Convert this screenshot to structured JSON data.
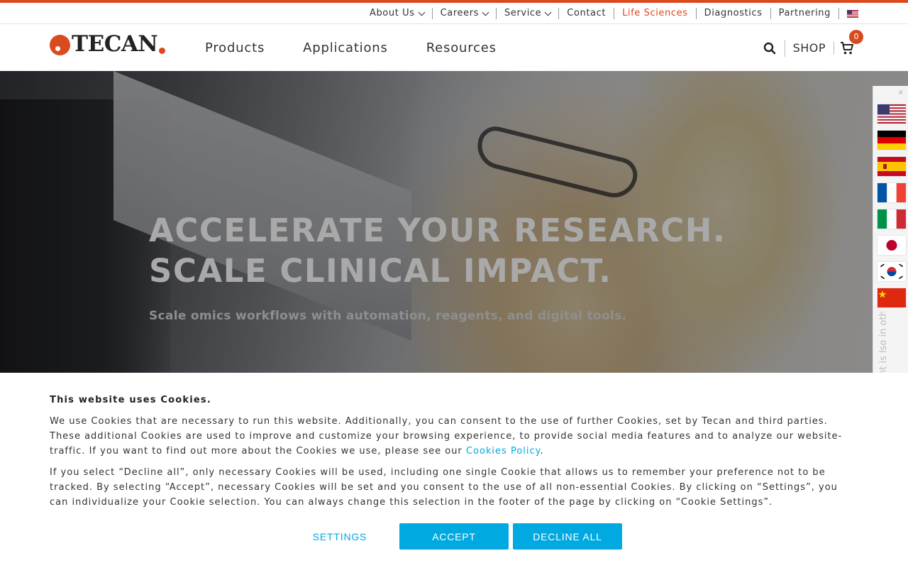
{
  "brand": {
    "logo_text": "TECAN",
    "accent_color": "#d94a1f",
    "link_color": "#00a9e0"
  },
  "utility_nav": {
    "items": [
      {
        "label": "About Us",
        "has_dropdown": true
      },
      {
        "label": "Careers",
        "has_dropdown": true
      },
      {
        "label": "Service",
        "has_dropdown": true
      },
      {
        "label": "Contact",
        "has_dropdown": false
      },
      {
        "label": "Life Sciences",
        "has_dropdown": false,
        "active": true
      },
      {
        "label": "Diagnostics",
        "has_dropdown": false
      },
      {
        "label": "Partnering",
        "has_dropdown": false
      }
    ],
    "region_flag": "us-flag-icon"
  },
  "main_nav": {
    "items": [
      {
        "label": "Products"
      },
      {
        "label": "Applications"
      },
      {
        "label": "Resources"
      }
    ],
    "search_icon": "search-icon",
    "shop_label": "SHOP",
    "cart_icon": "shopping-cart-icon",
    "cart_count": "0"
  },
  "hero": {
    "headline_line1": "ACCELERATE YOUR RESEARCH.",
    "headline_line2": "SCALE CLINICAL IMPACT.",
    "subline": "Scale omics workflows with automation, reagents, and digital tools."
  },
  "language_selector": {
    "flags": [
      "us-flag-icon",
      "germany-flag-icon",
      "spain-flag-icon",
      "france-flag-icon",
      "italy-flag-icon",
      "japan-flag-icon",
      "korea-flag-icon",
      "china-flag-icon"
    ],
    "note": "nt is\nlso in other"
  },
  "cookie_banner": {
    "title": "This website uses Cookies.",
    "paragraph1_before_link": "We use Cookies that are necessary to run this website. Additionally, you can consent to the use of further Cookies, set by Tecan and third parties. These additional Cookies are used to improve and customize your browsing experience, to provide social media features and to analyze our website-traffic. If you want to find out more about the Cookies we use, please see our ",
    "paragraph1_link": "Cookies Policy",
    "paragraph1_after_link": ".",
    "paragraph2": "If you select “Decline all”, only necessary Cookies will be used, including one single Cookie that allows us to remember your preference not to be tracked. By selecting “Accept”, necessary Cookies will be set and you consent to the use of all non-essential Cookies. By clicking on “Settings”, you can individualize your Cookie selection. You can always change this selection in the footer of the page by clicking on “Cookie Settings”.",
    "settings_label": "SETTINGS",
    "accept_label": "ACCEPT",
    "decline_label": "DECLINE ALL"
  }
}
